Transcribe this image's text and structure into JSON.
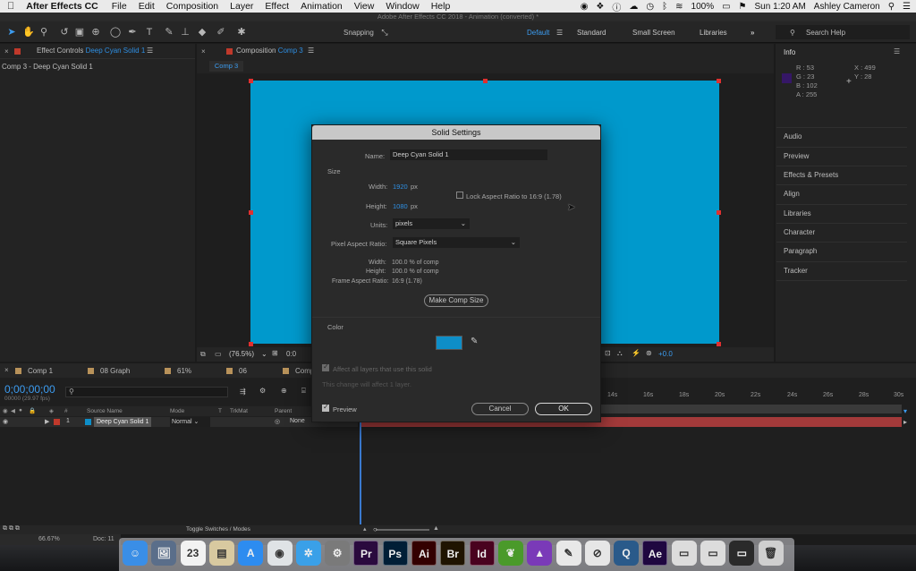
{
  "menubar": {
    "apple": "",
    "app_name": "After Effects CC",
    "items": [
      "File",
      "Edit",
      "Composition",
      "Layer",
      "Effect",
      "Animation",
      "View",
      "Window",
      "Help"
    ],
    "battery": "100%",
    "clock": "Sun 1:20 AM",
    "user": "Ashley Cameron"
  },
  "window_title": "Adobe After Effects CC 2018 - Animation (converted) *",
  "toolbar": {
    "snapping_label": "Snapping",
    "workspaces": [
      "Default",
      "Standard",
      "Small Screen",
      "Libraries"
    ],
    "search_placeholder": "Search Help"
  },
  "effect_controls": {
    "tab_prefix": "Effect Controls",
    "tab_layer": "Deep Cyan Solid 1",
    "subtitle": "Comp 3 - Deep Cyan Solid 1"
  },
  "composition": {
    "tab_prefix": "Composition",
    "tab_name": "Comp 3",
    "subtab": "Comp 3",
    "zoom": "(76.5%)",
    "frame_offset": "0:0",
    "exposure": "+0.0",
    "solid_color": "#0099cc"
  },
  "info_panel": {
    "title": "Info",
    "r": "R : 53",
    "g": "G : 23",
    "b": "B : 102",
    "a": "A : 255",
    "x": "X : 499",
    "y": "Y : 28",
    "swatch": "#351766"
  },
  "right_panels": [
    "Audio",
    "Preview",
    "Effects & Presets",
    "Align",
    "Libraries",
    "Character",
    "Paragraph",
    "Tracker"
  ],
  "dialog": {
    "title": "Solid Settings",
    "name_label": "Name:",
    "name_value": "Deep Cyan Solid 1",
    "size_section": "Size",
    "width_label": "Width:",
    "width_value": "1920",
    "px1": "px",
    "height_label": "Height:",
    "height_value": "1080",
    "px2": "px",
    "lock_label": "Lock Aspect Ratio to 16:9 (1.78)",
    "units_label": "Units:",
    "units_value": "pixels",
    "par_label": "Pixel Aspect Ratio:",
    "par_value": "Square Pixels",
    "info_width_label": "Width:",
    "info_width_value": "100.0 % of comp",
    "info_height_label": "Height:",
    "info_height_value": "100.0 % of comp",
    "far_label": "Frame Aspect Ratio:",
    "far_value": "16:9 (1.78)",
    "make_comp_size": "Make Comp Size",
    "color_section": "Color",
    "color_value": "#0e8ec8",
    "affect_all": "Affect all layers that use this solid",
    "affect_note": "This change will affect 1 layer.",
    "preview_label": "Preview",
    "cancel": "Cancel",
    "ok": "OK"
  },
  "timeline": {
    "tabs": [
      "Comp 1",
      "08 Graph",
      "61%",
      "06",
      "Comp"
    ],
    "timecode": "0;00;00;00",
    "fps": "00000 (29.97 fps)",
    "columns": {
      "source_name": "Source Name",
      "mode": "Mode",
      "t": "T",
      "trkmat": "TrkMat",
      "parent": "Parent"
    },
    "layer": {
      "index": "1",
      "name": "Deep Cyan Solid 1",
      "mode": "Normal",
      "parent": "None"
    },
    "ruler": [
      "14s",
      "16s",
      "18s",
      "20s",
      "22s",
      "24s",
      "26s",
      "28s",
      "30s"
    ],
    "toggle_label": "Toggle Switches / Modes",
    "status_zoom": "66.67%",
    "status_doc": "Doc: 11"
  },
  "dock": [
    {
      "name": "finder",
      "label": "☺",
      "bg": "#3a8ee6"
    },
    {
      "name": "preview",
      "label": "🖼",
      "bg": "#5a6e8a"
    },
    {
      "name": "calendar",
      "label": "23",
      "bg": "#f2f2f2"
    },
    {
      "name": "notes",
      "label": "▤",
      "bg": "#d8c9a0"
    },
    {
      "name": "app-store",
      "label": "A",
      "bg": "#2d8cf0"
    },
    {
      "name": "chrome",
      "label": "◉",
      "bg": "#dfe3e6"
    },
    {
      "name": "safari",
      "label": "✲",
      "bg": "#3aa0e8"
    },
    {
      "name": "system-prefs",
      "label": "⚙",
      "bg": "#7a7a7a"
    },
    {
      "name": "premiere",
      "label": "Pr",
      "bg": "#2a0a3e"
    },
    {
      "name": "photoshop",
      "label": "Ps",
      "bg": "#001e36"
    },
    {
      "name": "illustrator",
      "label": "Ai",
      "bg": "#330000"
    },
    {
      "name": "bridge",
      "label": "Br",
      "bg": "#1f1400"
    },
    {
      "name": "indesign",
      "label": "Id",
      "bg": "#49021f"
    },
    {
      "name": "leaf-app",
      "label": "❦",
      "bg": "#4a9a2a"
    },
    {
      "name": "vpn-app",
      "label": "▲",
      "bg": "#7a3ab8"
    },
    {
      "name": "textedit",
      "label": "✎",
      "bg": "#e8e8e8"
    },
    {
      "name": "no-sign-app",
      "label": "⊘",
      "bg": "#e6e6e6"
    },
    {
      "name": "quicktime",
      "label": "Q",
      "bg": "#2a5a8a"
    },
    {
      "name": "after-effects",
      "label": "Ae",
      "bg": "#1f0740"
    },
    {
      "name": "doc-1",
      "label": "▭",
      "bg": "#dcdcdc"
    },
    {
      "name": "doc-2",
      "label": "▭",
      "bg": "#dcdcdc"
    },
    {
      "name": "doc-3",
      "label": "▭",
      "bg": "#2a2a2a"
    },
    {
      "name": "trash",
      "label": "🗑",
      "bg": "#cfcfcf"
    }
  ]
}
